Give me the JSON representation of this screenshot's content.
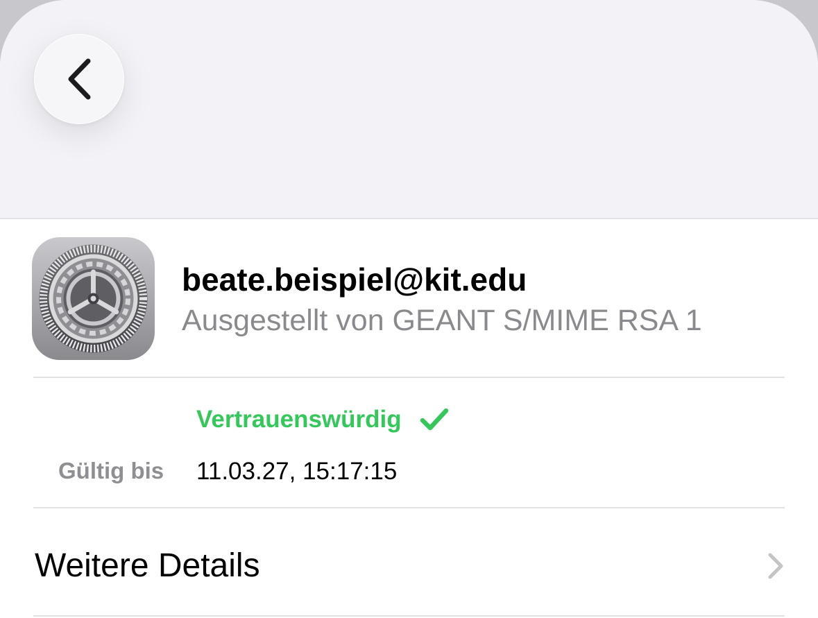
{
  "header": {
    "back_icon": "chevron-left-icon"
  },
  "profile": {
    "icon": "settings-gear-icon",
    "title": "beate.beispiel@kit.edu",
    "subtitle": "Ausgestellt von GEANT S/MIME RSA 1"
  },
  "status": {
    "trust_label": "Vertrauenswürdig",
    "trust_icon": "checkmark-icon",
    "trust_color": "#34c759",
    "valid_label": "Gültig bis",
    "valid_value": "11.03.27, 15:17:15"
  },
  "more": {
    "label": "Weitere Details",
    "icon": "chevron-right-icon"
  }
}
